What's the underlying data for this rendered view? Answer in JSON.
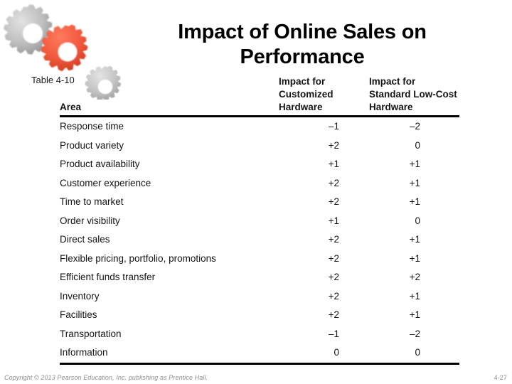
{
  "slide": {
    "title": "Impact of Online Sales on Performance",
    "table_label": "Table 4-10",
    "logo_icon": "three-gears-icon",
    "accent_color": "#e8503a",
    "gray_color": "#b8b8b8"
  },
  "table": {
    "headers": {
      "area": "Area",
      "col1": "Impact for Customized Hardware",
      "col2": "Impact for Standard Low-Cost Hardware"
    },
    "rows": [
      {
        "area": "Response time",
        "col1": "–1",
        "col2": "–2"
      },
      {
        "area": "Product variety",
        "col1": "+2",
        "col2": "0"
      },
      {
        "area": "Product availability",
        "col1": "+1",
        "col2": "+1"
      },
      {
        "area": "Customer experience",
        "col1": "+2",
        "col2": "+1"
      },
      {
        "area": "Time to market",
        "col1": "+2",
        "col2": "+1"
      },
      {
        "area": "Order visibility",
        "col1": "+1",
        "col2": "0"
      },
      {
        "area": "Direct sales",
        "col1": "+2",
        "col2": "+1"
      },
      {
        "area": "Flexible pricing, portfolio, promotions",
        "col1": "+2",
        "col2": "+1"
      },
      {
        "area": "Efficient funds transfer",
        "col1": "+2",
        "col2": "+2"
      },
      {
        "area": "Inventory",
        "col1": "+2",
        "col2": "+1"
      },
      {
        "area": "Facilities",
        "col1": "+2",
        "col2": "+1"
      },
      {
        "area": "Transportation",
        "col1": "–1",
        "col2": "–2"
      },
      {
        "area": "Information",
        "col1": "0",
        "col2": "0"
      }
    ]
  },
  "footer": {
    "copyright": "Copyright © 2013 Pearson Education, Inc. publishing as Prentice Hall.",
    "page": "4-27"
  }
}
